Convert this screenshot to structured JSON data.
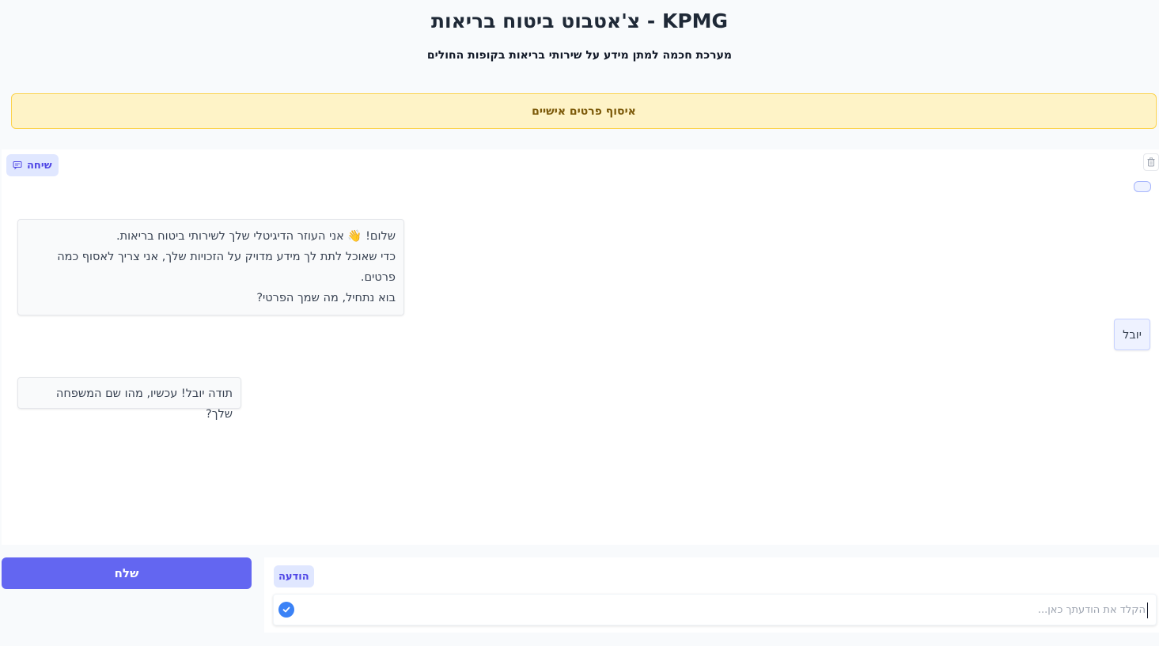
{
  "header": {
    "title": "KPMG - צ'אטבוט ביטוח בריאות",
    "subtitle": "מערכת חכמה למתן מידע על שירותי בריאות בקופות החולים"
  },
  "banner": {
    "text": "איסוף פרטים אישיים"
  },
  "chat": {
    "label": "שיחה",
    "messages": [
      {
        "role": "bot",
        "lines": [
          "שלום! 👋 אני העוזר הדיגיטלי שלך לשירותי ביטוח בריאות.",
          "כדי שאוכל לתת לך מידע מדויק על הזכויות שלך, אני צריך לאסוף כמה פרטים.",
          "בוא נתחיל, מה שמך הפרטי?"
        ]
      },
      {
        "role": "user",
        "text": "יובל"
      },
      {
        "role": "bot",
        "text": "תודה יובל! עכשיו, מהו שם המשפחה שלך?"
      }
    ]
  },
  "input": {
    "label": "הודעה",
    "placeholder": "הקלד את הודעתך כאן...",
    "value": ""
  },
  "send": {
    "label": "שלח"
  },
  "icons": {
    "chat": "chat-bubble-icon",
    "trash": "trash-icon",
    "submit": "check-circle-icon"
  },
  "colors": {
    "accent": "#6366f1",
    "banner_bg": "#fef3c7",
    "label_bg": "#e0e7ff"
  }
}
